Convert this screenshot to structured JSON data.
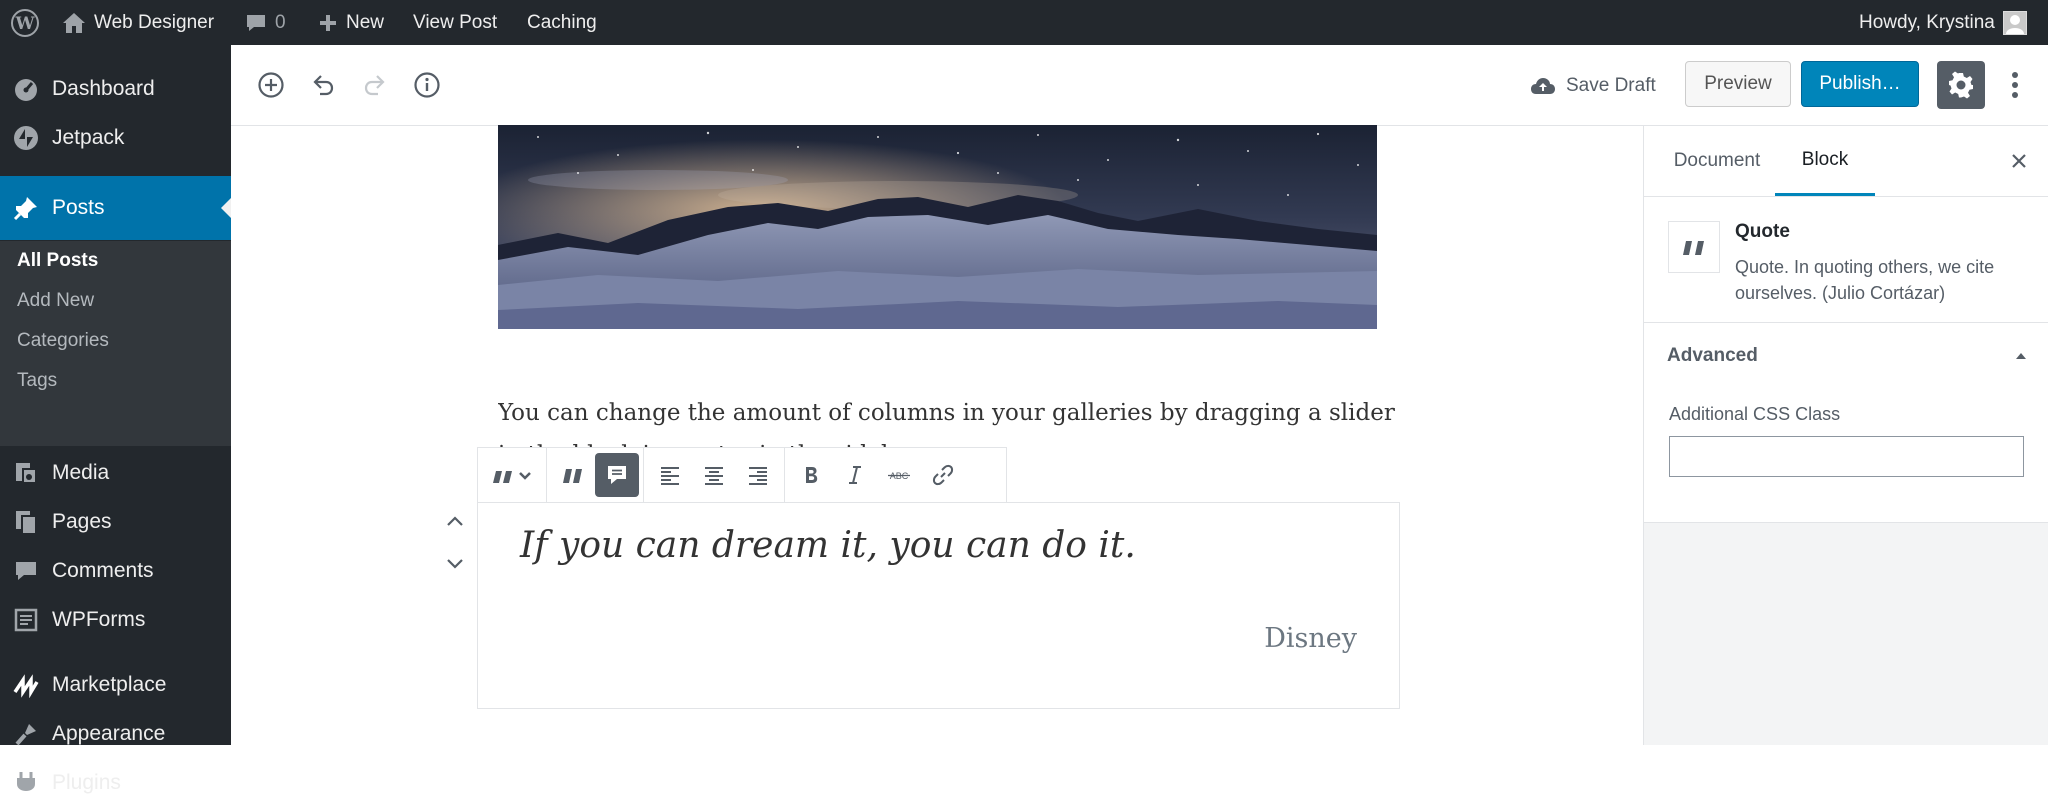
{
  "admin_bar": {
    "site_name": "Web Designer",
    "comments_count": "0",
    "new_label": "New",
    "view_post_label": "View Post",
    "caching_label": "Caching",
    "greeting": "Howdy, Krystina"
  },
  "sidebar": {
    "items": [
      {
        "label": "Dashboard",
        "icon": "dashboard-icon"
      },
      {
        "label": "Jetpack",
        "icon": "jetpack-icon"
      },
      {
        "label": "Posts",
        "icon": "pin-icon"
      },
      {
        "label": "Media",
        "icon": "media-icon"
      },
      {
        "label": "Pages",
        "icon": "pages-icon"
      },
      {
        "label": "Comments",
        "icon": "comments-icon"
      },
      {
        "label": "WPForms",
        "icon": "wpforms-icon"
      },
      {
        "label": "Marketplace",
        "icon": "marketplace-icon"
      },
      {
        "label": "Appearance",
        "icon": "appearance-icon"
      },
      {
        "label": "Plugins",
        "icon": "plugins-icon"
      }
    ],
    "posts_submenu": [
      "All Posts",
      "Add New",
      "Categories",
      "Tags"
    ]
  },
  "editor_header": {
    "save_draft_label": "Save Draft",
    "preview_label": "Preview",
    "publish_label": "Publish…"
  },
  "content": {
    "paragraph": "You can change the amount of columns in your galleries by dragging a slider in the block inspector in the sidebar.",
    "quote_text": "If you can dream it, you can do it.",
    "quote_citation": "Disney"
  },
  "inspector": {
    "tabs": [
      "Document",
      "Block"
    ],
    "active_tab": "Block",
    "block_name": "Quote",
    "block_description": "Quote. In quoting others, we cite ourselves. (Julio Cortázar)",
    "advanced_title": "Advanced",
    "css_class_label": "Additional CSS Class",
    "css_class_value": ""
  },
  "colors": {
    "admin_dark": "#23282d",
    "admin_blue": "#0073aa",
    "publish_blue": "#0085ba",
    "submenu_bg": "#32373c",
    "inspector_bg": "#f3f4f5"
  }
}
